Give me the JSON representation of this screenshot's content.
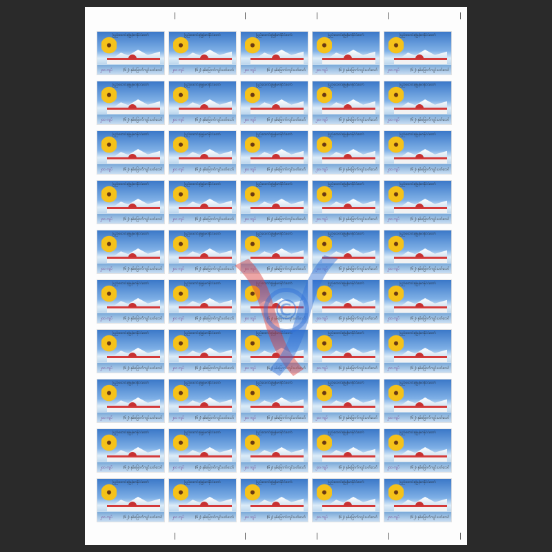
{
  "stamp": {
    "top_text": "ပြည်ထောင်စုမြန်မာနိုင်ငံတော်",
    "value": "၂၀၀ ကျပ်",
    "caption": "(၆၂) နှစ်မြောက်ကျင်းပတ်သော်"
  },
  "sheet": {
    "rows": 10,
    "columns": 5
  },
  "watermark": {
    "symbol": "©",
    "colors": [
      "#d93a3a",
      "#2f6fd6"
    ]
  }
}
